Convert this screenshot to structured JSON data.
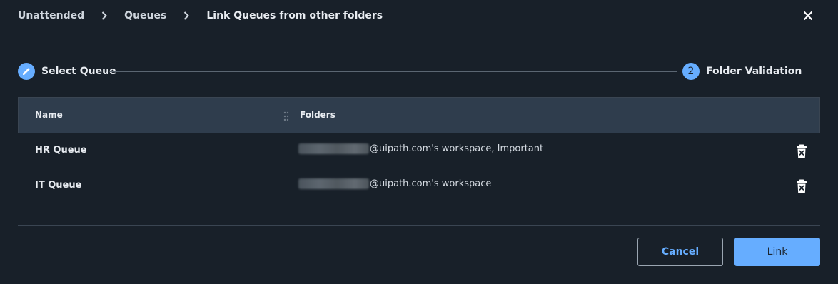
{
  "breadcrumb": {
    "items": [
      "Unattended",
      "Queues"
    ],
    "current": "Link Queues from other folders"
  },
  "stepper": {
    "step1": {
      "label": "Select Queue",
      "icon": "pencil-icon"
    },
    "step2": {
      "number": "2",
      "label": "Folder Validation"
    }
  },
  "table": {
    "columns": {
      "name": "Name",
      "folders": "Folders"
    },
    "rows": [
      {
        "name": "HR Queue",
        "folders": "@uipath.com's workspace, Important"
      },
      {
        "name": "IT Queue",
        "folders": "@uipath.com's workspace"
      }
    ]
  },
  "footer": {
    "cancel_label": "Cancel",
    "link_label": "Link"
  },
  "colors": {
    "accent": "#66adff",
    "background": "#182029",
    "header_bg": "#2f3d4d"
  }
}
